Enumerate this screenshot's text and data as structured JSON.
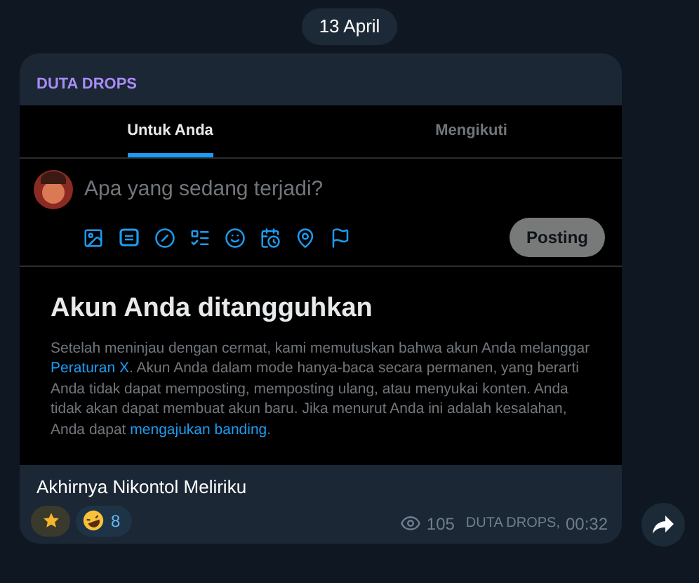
{
  "date_pill": "13 April",
  "post": {
    "channel": "DUTA DROPS",
    "screenshot": {
      "tabs": [
        {
          "label": "Untuk Anda",
          "selected": true
        },
        {
          "label": "Mengikuti",
          "selected": false
        }
      ],
      "compose": {
        "placeholder": "Apa yang sedang terjadi?",
        "post_button": {
          "label": "Posting",
          "disabled": true
        }
      },
      "notice": {
        "title": "Akun Anda ditangguhkan",
        "body": [
          {
            "kind": "text",
            "text": "Setelah meninjau dengan cermat, kami memutuskan bahwa akun Anda melanggar "
          },
          {
            "kind": "link",
            "text": "Peraturan X"
          },
          {
            "kind": "text",
            "text": ". Akun Anda dalam mode hanya-baca secara permanen, yang berarti Anda tidak dapat memposting, memposting ulang, atau menyukai konten. Anda tidak akan dapat membuat akun baru. Jika menurut Anda ini adalah kesalahan, Anda dapat "
          },
          {
            "kind": "link",
            "text": "mengajukan banding"
          },
          {
            "kind": "text",
            "text": "."
          }
        ]
      }
    },
    "caption": "Akhirnya Nikontol Meliriku",
    "reactions": [
      {
        "kind": "star"
      },
      {
        "kind": "laugh",
        "count": "8"
      }
    ],
    "views": "105",
    "signature": "DUTA DROPS,",
    "time": "00:32"
  }
}
